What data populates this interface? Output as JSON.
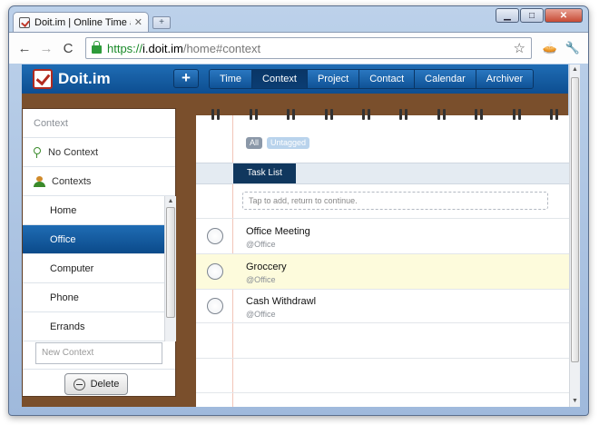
{
  "browser": {
    "tab_title": "Doit.im | Online Time an...",
    "tab_close": "✕",
    "new_tab": "+",
    "url_scheme": "https://",
    "url_host": "i.doit.im",
    "url_path": "/home#context",
    "back": "←",
    "forward": "→",
    "reload": "C",
    "star": "☆",
    "wrench": "🔧",
    "extension": "🥧",
    "minimize": "▁",
    "maximize": "□",
    "close": "✕"
  },
  "app": {
    "logo": "Doit.im",
    "add_label": "+",
    "nav": [
      {
        "label": "Time"
      },
      {
        "label": "Context"
      },
      {
        "label": "Project"
      },
      {
        "label": "Contact"
      },
      {
        "label": "Calendar"
      },
      {
        "label": "Archiver"
      }
    ],
    "active_nav": "Context"
  },
  "sidebar": {
    "header": "Context",
    "no_context": "No Context",
    "contexts": "Contexts",
    "items": [
      {
        "label": "Home"
      },
      {
        "label": "Office"
      },
      {
        "label": "Computer"
      },
      {
        "label": "Phone"
      },
      {
        "label": "Errands"
      }
    ],
    "active_item": "Office",
    "new_context_placeholder": "New Context",
    "delete_label": "Delete"
  },
  "main": {
    "filters": [
      "All",
      "Untagged"
    ],
    "task_list_tab": "Task List",
    "add_placeholder": "Tap to add, return to continue.",
    "tasks": [
      {
        "title": "Office Meeting",
        "context": "@Office",
        "highlighted": false
      },
      {
        "title": "Groccery",
        "context": "@Office",
        "highlighted": true
      },
      {
        "title": "Cash Withdrawl",
        "context": "@Office",
        "highlighted": false
      }
    ]
  },
  "colors": {
    "header_blue": "#0d4e91",
    "active_blue": "#0b4a8a",
    "wood": "#7a4f2c",
    "highlight_row": "#fdfbdc"
  }
}
